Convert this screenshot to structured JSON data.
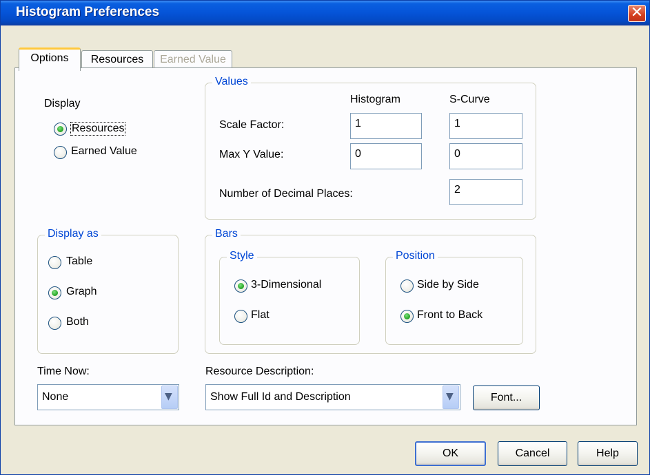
{
  "window": {
    "title": "Histogram Preferences"
  },
  "tabs": [
    {
      "label": "Options",
      "state": "active"
    },
    {
      "label": "Resources",
      "state": "normal"
    },
    {
      "label": "Earned Value",
      "state": "disabled"
    }
  ],
  "display": {
    "label": "Display",
    "options": [
      {
        "label": "Resources",
        "checked": true
      },
      {
        "label": "Earned Value",
        "checked": false
      }
    ]
  },
  "values": {
    "legend": "Values",
    "col_histogram": "Histogram",
    "col_scurve": "S-Curve",
    "scale_factor_label": "Scale Factor:",
    "scale_factor_histogram": "1",
    "scale_factor_scurve": "1",
    "max_y_label": "Max Y Value:",
    "max_y_histogram": "0",
    "max_y_scurve": "0",
    "decimal_places_label": "Number of Decimal Places:",
    "decimal_places": "2"
  },
  "display_as": {
    "legend": "Display as",
    "options": [
      {
        "label": "Table",
        "checked": false
      },
      {
        "label": "Graph",
        "checked": true
      },
      {
        "label": "Both",
        "checked": false
      }
    ]
  },
  "bars": {
    "legend": "Bars",
    "style": {
      "legend": "Style",
      "options": [
        {
          "label": "3-Dimensional",
          "checked": true
        },
        {
          "label": "Flat",
          "checked": false
        }
      ]
    },
    "position": {
      "legend": "Position",
      "options": [
        {
          "label": "Side by Side",
          "checked": false
        },
        {
          "label": "Front to Back",
          "checked": true
        }
      ]
    }
  },
  "time_now": {
    "label": "Time Now:",
    "value": "None"
  },
  "resource_description": {
    "label": "Resource Description:",
    "value": "Show Full Id and Description"
  },
  "buttons": {
    "font": "Font...",
    "ok": "OK",
    "cancel": "Cancel",
    "help": "Help"
  }
}
